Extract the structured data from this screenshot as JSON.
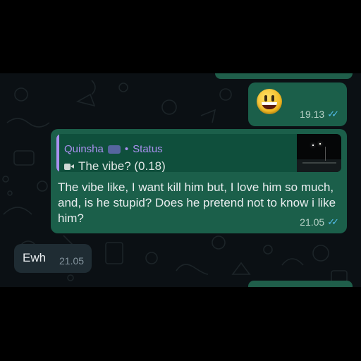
{
  "messages": {
    "emoji_msg": {
      "emoji": "grinning-face",
      "time": "19.13",
      "status_ticks": "✓✓"
    },
    "reply_msg": {
      "quote": {
        "author": "Quinsha",
        "separator": "•",
        "source": "Status",
        "body": "The vibe? (0.18)",
        "body_icon": "video-camera-icon"
      },
      "text": "The vibe like, I want kill him but, I love him so much, and, is he stupid? Does he pretend not to know i like him?",
      "time": "21.05",
      "status_ticks": "✓✓"
    },
    "incoming_msg": {
      "text": "Ewh",
      "time": "21.05"
    }
  },
  "colors": {
    "chat_background": "#0b1014",
    "outgoing_bubble": "#1b5f4a",
    "incoming_bubble": "#1f2c33",
    "quote_accent": "#a990ef",
    "read_ticks": "#53bdeb"
  }
}
